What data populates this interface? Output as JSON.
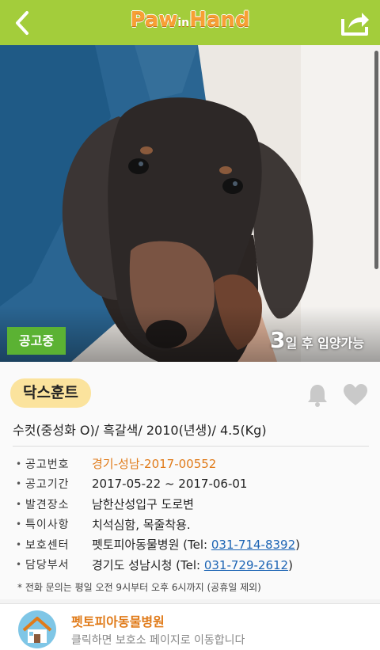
{
  "header": {
    "logo_paw": "Paw",
    "logo_in": "in",
    "logo_hand": "Hand"
  },
  "photo": {
    "status_badge": "공고중",
    "days_number": "3",
    "days_text": "일 후 입양가능"
  },
  "animal": {
    "breed": "닥스훈트",
    "summary": "수컷(중성화 O)/ 흑갈색/ 2010(년생)/ 4.5(Kg)"
  },
  "details": [
    {
      "label": "공고번호",
      "value": "경기-성남-2017-00552"
    },
    {
      "label": "공고기간",
      "value": "2017-05-22 ~ 2017-06-01"
    },
    {
      "label": "발견장소",
      "value": "남한산성입구 도로변"
    },
    {
      "label": "특이사항",
      "value": "치석심함, 목줄착용."
    },
    {
      "label": "보호센터",
      "value": "펫토피아동물병원 (Tel: ",
      "phone": "031-714-8392",
      "suffix": ")"
    },
    {
      "label": "담당부서",
      "value": "경기도 성남시청 (Tel: ",
      "phone": "031-729-2612",
      "suffix": ")"
    }
  ],
  "notice": "* 전화 문의는 평일 오전 9시부터 오후 6시까지 (공휴일 제외)",
  "shelter": {
    "name": "펫토피아동물병원",
    "hint": "클릭하면 보호소 페이지로 이동합니다"
  },
  "colors": {
    "header": "#a3cd3b",
    "badge": "#5bb233",
    "breed_pill": "#fbe39d",
    "accent_orange": "#e07b1a",
    "link_blue": "#1c64b4"
  }
}
